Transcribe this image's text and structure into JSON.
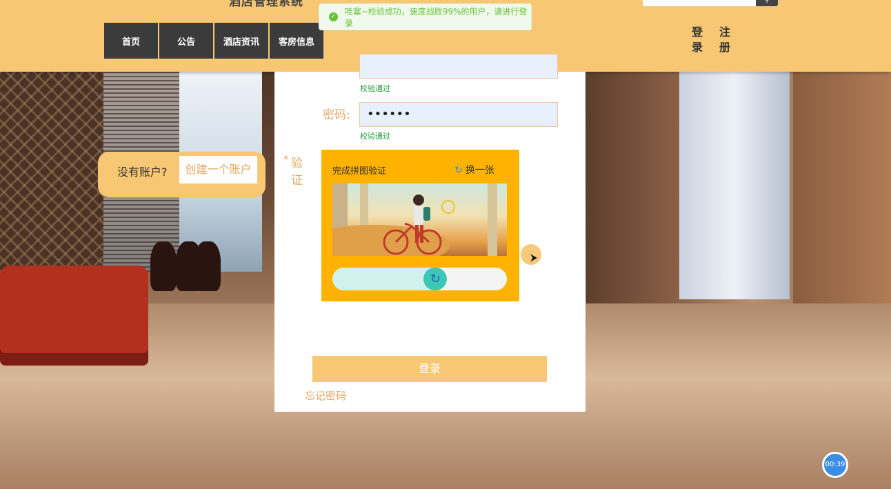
{
  "header": {
    "site_title": "酒店管理系统",
    "nav": [
      "首页",
      "公告",
      "酒店资讯",
      "客房信息"
    ],
    "auth_login": [
      "登",
      "录"
    ],
    "auth_register": [
      "注",
      "册"
    ]
  },
  "toast": {
    "message": "哇塞~检验成功，速度战胜99%的用户，请进行登录"
  },
  "form": {
    "validation_ok_1": "校验通过",
    "password_label": "密码:",
    "password_value": "••••••",
    "validation_ok_2": "校验通过",
    "verify_label_line1": "验",
    "verify_label_line2": "证",
    "required_mark": "*"
  },
  "captcha": {
    "title": "完成拼图验证",
    "refresh_label": "换一张",
    "slider_progress": 0.59
  },
  "login_button": "登录",
  "forgot_password": "忘记密码",
  "no_account": {
    "question": "没有账户?",
    "create_link": "创建一个账户"
  },
  "timer": "00:39",
  "colors": {
    "header_bg": "#f7c774",
    "nav_bg": "#3b3b3b",
    "captcha_bg": "#ffb300",
    "accent_text": "#e3a866",
    "success": "#67c23a"
  }
}
